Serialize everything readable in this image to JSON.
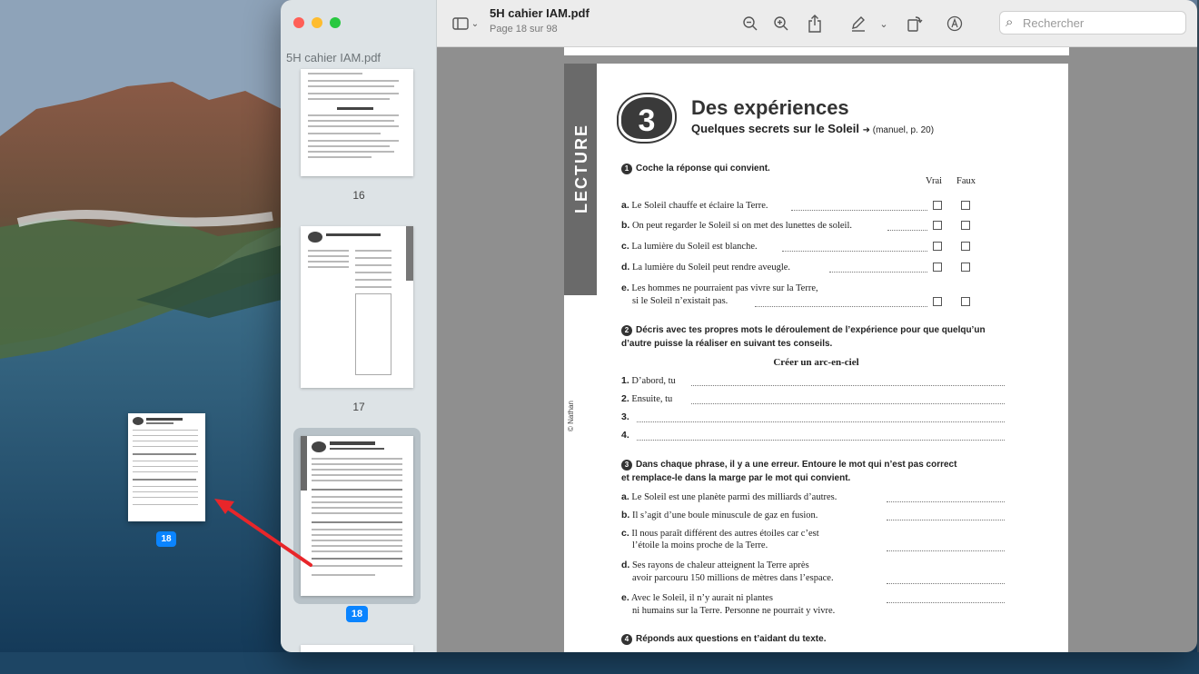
{
  "window": {
    "document_title": "5H cahier IAM.pdf",
    "page_indicator": "Page 18 sur 98"
  },
  "sidebar": {
    "title": "5H cahier IAM.pdf",
    "thumbnails": [
      {
        "label": "16"
      },
      {
        "label": "17"
      },
      {
        "label": "18",
        "selected": true
      }
    ]
  },
  "toolbar": {
    "icons": [
      "sidebar-toggle-icon",
      "chevron-down-icon",
      "zoom-out-icon",
      "zoom-in-icon",
      "share-icon",
      "markup-pen-icon",
      "chevron-down-icon",
      "rotate-icon",
      "annotate-icon"
    ],
    "search_placeholder": "Rechercher"
  },
  "page": {
    "band_label": "LECTURE",
    "copyright": "© Nathan",
    "number": "3",
    "title": "Des expériences",
    "subtitle": "Quelques secrets sur le Soleil",
    "subtitle_ref": "➜ (manuel, p. 20)",
    "q1": {
      "num": "1",
      "instruction": "Coche la réponse qui convient.",
      "col_true": "Vrai",
      "col_false": "Faux",
      "items": [
        {
          "letter": "a.",
          "text": "Le Soleil chauffe et éclaire la Terre."
        },
        {
          "letter": "b.",
          "text": "On peut regarder le Soleil si on met des lunettes de soleil."
        },
        {
          "letter": "c.",
          "text": "La lumière du Soleil est blanche."
        },
        {
          "letter": "d.",
          "text": "La lumière du Soleil peut rendre aveugle."
        },
        {
          "letter": "e.",
          "text": "Les hommes ne pourraient pas vivre sur la Terre,"
        }
      ],
      "item_e_line2": "si le Soleil n’existait pas."
    },
    "q2": {
      "num": "2",
      "instruction_l1": "Décris avec tes propres mots le déroulement de l’expérience pour que quelqu’un",
      "instruction_l2": "d’autre puisse la réaliser en suivant tes conseils.",
      "heading": "Créer un arc-en-ciel",
      "lines": [
        {
          "num": "1.",
          "text": "D’abord, tu"
        },
        {
          "num": "2.",
          "text": "Ensuite, tu"
        },
        {
          "num": "3.",
          "text": ""
        },
        {
          "num": "4.",
          "text": ""
        }
      ]
    },
    "q3": {
      "num": "3",
      "instruction_l1": "Dans chaque phrase, il y a une erreur. Entoure le mot qui n’est pas correct",
      "instruction_l2": "et remplace-le dans la marge par le mot qui convient.",
      "items": [
        {
          "letter": "a.",
          "l1": "Le Soleil est une planète parmi des milliards d’autres.",
          "l2": ""
        },
        {
          "letter": "b.",
          "l1": "Il s’agit d’une boule minuscule de gaz en fusion.",
          "l2": ""
        },
        {
          "letter": "c.",
          "l1": "Il nous paraît différent des autres étoiles car c’est",
          "l2": "l’étoile la moins proche de la Terre."
        },
        {
          "letter": "d.",
          "l1": "Ses rayons de chaleur atteignent la Terre après",
          "l2": "avoir parcouru 150 millions de mètres dans l’espace."
        },
        {
          "letter": "e.",
          "l1": "Avec le Soleil, il n’y aurait ni plantes",
          "l2": "ni humains sur la Terre. Personne ne pourrait y vivre."
        }
      ]
    },
    "q4": {
      "num": "4",
      "instruction": "Réponds aux questions en t’aidant du texte."
    }
  },
  "desktop": {
    "dragged_page_badge": "18"
  },
  "colors": {
    "accent": "#0a84ff",
    "arrow": "#e8262a",
    "band": "#6a6a6a"
  }
}
